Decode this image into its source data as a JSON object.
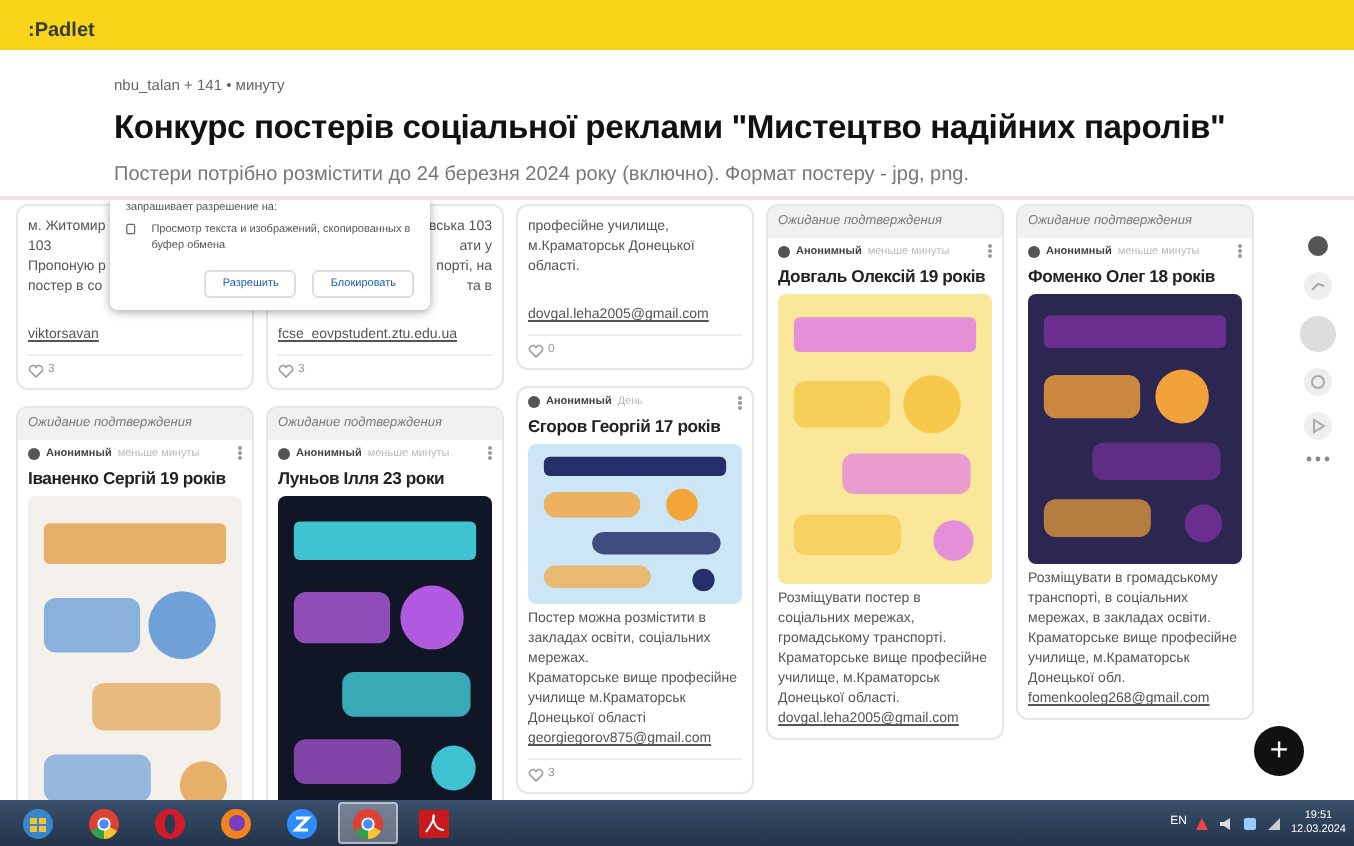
{
  "app_bar": {
    "logo": ":Padlet"
  },
  "header": {
    "meta": "nbu_talan + 141 •  минуту",
    "title": "Конкурс постерів соціальної реклами \"Мистецтво надійних паролів\"",
    "description": "Постери потрібно розмістити до 24 березня 2024 року (включно). Формат постеру - jpg, png."
  },
  "columns": [
    {
      "cards": [
        {
          "body": "м. Житомир\n103\nПропоную р\nпостер в со",
          "link": "viktorsavan",
          "likes": "3"
        },
        {
          "pending": "Ожидание подтверждения",
          "author": "Анонимный",
          "time": "меньше минуты",
          "title": "Іваненко Сергій  19 років"
        }
      ]
    },
    {
      "cards": [
        {
          "body": "вська 103\nати у\nпорті, на\nта в",
          "link": "fcse_eovpstudent.ztu.edu.ua",
          "likes": "3"
        },
        {
          "pending": "Ожидание подтверждения",
          "author": "Анонимный",
          "time": "меньше минуты",
          "title": "Луньов Ілля  23 роки"
        }
      ]
    },
    {
      "cards": [
        {
          "body": "професійне училище,\nм.Краматорськ Донецької\nобласті.",
          "link": "dovgal.leha2005@gmail.com",
          "likes": "0"
        },
        {
          "author": "Анонимный",
          "time": "День",
          "title": "Єгоров Георгій  17 років",
          "body": "Постер можна розмістити в закладах освіти, соціальних мережах.\nКраматорське вище професійне училище м.Краматорськ Донецької області",
          "link": "georgiegorov875@gmail.com",
          "likes": "3"
        }
      ]
    },
    {
      "cards": [
        {
          "pending": "Ожидание подтверждения",
          "author": "Анонимный",
          "time": "меньше минуты",
          "title": "Довгаль Олексій  19 років",
          "body": "Розміщувати постер в соціальних мережах, громадському транспорті. Краматорське вище професійне училище, м.Краматорськ Донецької області.",
          "link": "dovgal.leha2005@gmail.com"
        }
      ]
    },
    {
      "cards": [
        {
          "pending": "Ожидание подтверждения",
          "author": "Анонимный",
          "time": "меньше минуты",
          "title": "Фоменко Олег  18 років",
          "body": "Розміщувати в громадському транспорті, в соціальних мережах, в закладах освіти. Краматорське вище професійне училище, м.Краматорськ Донецької обл.",
          "link": "fomenkooleg268@gmail.com"
        }
      ]
    }
  ],
  "permission_popup": {
    "heading": "запрашивает разрешение на:",
    "text": "Просмотр текста и изображений, скопированных в буфер обмена",
    "buttons": [
      "Разрешить",
      "Блокировать"
    ]
  },
  "fab": {
    "label": "+"
  },
  "taskbar": {
    "apps": [
      {
        "kind": "start",
        "selected": false
      },
      {
        "kind": "chrome",
        "selected": false
      },
      {
        "kind": "opera",
        "selected": false
      },
      {
        "kind": "firefox",
        "selected": false
      },
      {
        "kind": "zoom",
        "selected": false
      },
      {
        "kind": "chrome",
        "selected": true
      },
      {
        "kind": "pdf",
        "selected": false
      }
    ],
    "language": "EN",
    "time": "19:51",
    "date": "12.03.2024"
  }
}
